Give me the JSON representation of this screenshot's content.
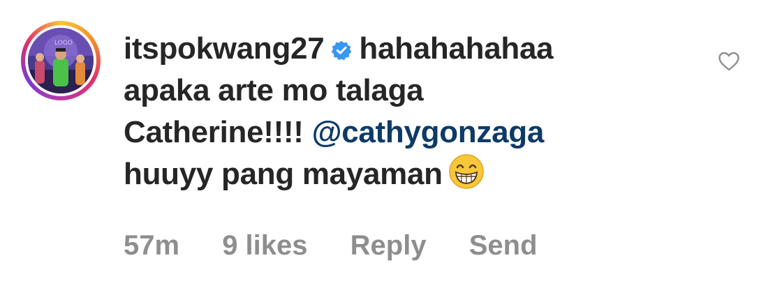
{
  "comment": {
    "username": "itspokwang27",
    "verified": true,
    "text_line1": "hahahahahaa",
    "text_line2": "apaka arte mo talaga",
    "text_line3_start": "Catherine!!!!",
    "mention": "@cathygonzaga",
    "text_line4": "huuyy pang mayaman",
    "emoji": "grinning-face-with-smiling-eyes"
  },
  "meta": {
    "time": "57m",
    "likes": "9 likes",
    "reply_label": "Reply",
    "send_label": "Send"
  },
  "colors": {
    "text": "#262626",
    "mention": "#0e3a66",
    "muted": "#8e8e8e",
    "verified_badge": "#3897f0"
  },
  "icons": {
    "like": "heart-outline-icon",
    "verified": "verified-badge-icon"
  }
}
